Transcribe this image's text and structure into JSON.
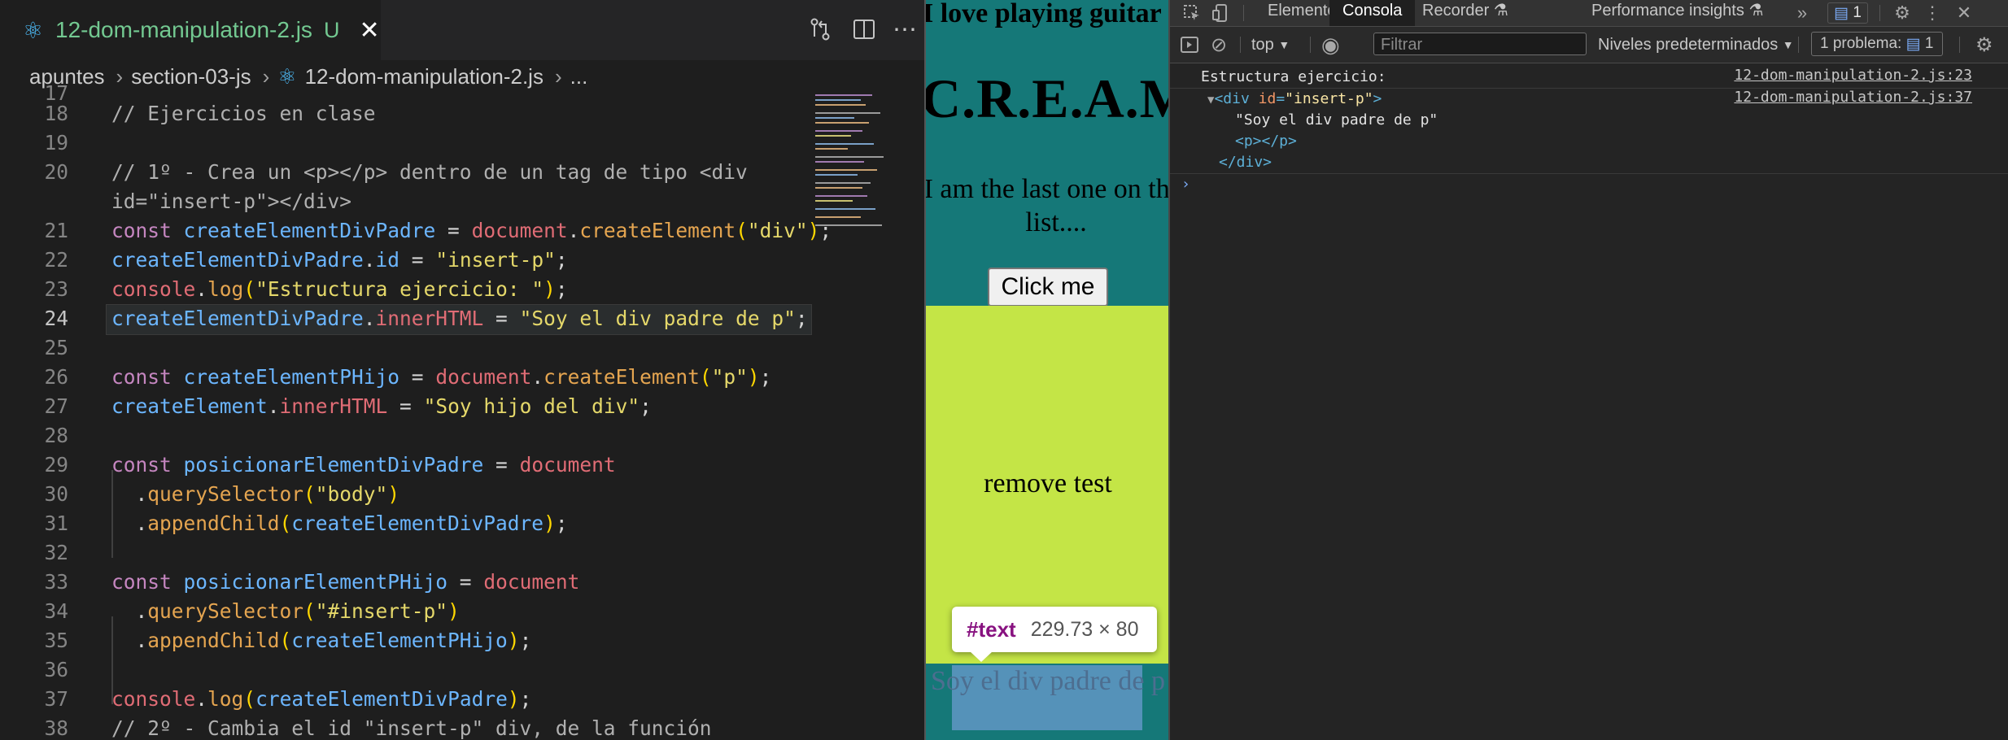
{
  "editor": {
    "tab": {
      "filename": "12-dom-manipulation-2.js",
      "status": "U",
      "close": "✕"
    },
    "breadcrumb": [
      "apuntes",
      "section-03-js",
      "12-dom-manipulation-2.js",
      "..."
    ],
    "lines": [
      {
        "n": "17",
        "t": ""
      },
      {
        "n": "18",
        "t": "// Ejercicios en clase"
      },
      {
        "n": "19",
        "t": ""
      },
      {
        "n": "20",
        "t": "// 1º - Crea un <p></p> dentro de un tag de tipo <div"
      },
      {
        "n": "",
        "t": "id=\"insert-p\"></div>"
      },
      {
        "n": "21",
        "t": "const createlementDivPadre"
      },
      {
        "n": "22",
        "t": "createElementDivPadre.id = \"insert-p\";"
      },
      {
        "n": "23",
        "t": "console.log(\"Estructura ejercicio: \");"
      },
      {
        "n": "24",
        "t": "createElementDivPadre.innerHTML = \"Soy el div padre de p\";"
      },
      {
        "n": "25",
        "t": ""
      },
      {
        "n": "26",
        "t": "const createElementPHijo = document.createElement(\"p\");"
      },
      {
        "n": "27",
        "t": "createElement.innerHTML = \"Soy hijo del div\";"
      },
      {
        "n": "28",
        "t": ""
      },
      {
        "n": "29",
        "t": "const posicionarElementDivPadre = document"
      },
      {
        "n": "30",
        "t": "  .querySelector(\"body\")"
      },
      {
        "n": "31",
        "t": "  .appendChild(createElementDivPadre);"
      },
      {
        "n": "32",
        "t": ""
      },
      {
        "n": "33",
        "t": "const posicionarElementPHijo = document"
      },
      {
        "n": "34",
        "t": "  .querySelector(\"#insert-p\")"
      },
      {
        "n": "35",
        "t": "  .appendChild(createElementPHijo);"
      },
      {
        "n": "36",
        "t": ""
      },
      {
        "n": "37",
        "t": "console.log(createElementDivPadre);"
      },
      {
        "n": "38",
        "t": "// 2º - Cambia el id \"insert-p\" div, de la función"
      }
    ],
    "code": {
      "l18": "// Ejercicios en clase",
      "l20a": "// 1º - Crea un <p></p> dentro de un tag de tipo <div",
      "l20b": "id=\"insert-p\"></div>",
      "kw_const": "const",
      "v_divpadre": "createElementDivPadre",
      "v_phijo": "createElementPHijo",
      "v_createElement": "createElement",
      "v_posDiv": "posicionarElementDivPadre",
      "v_posP": "posicionarElementPHijo",
      "o_document": "document",
      "o_console": "console",
      "f_createElement": "createElement",
      "f_log": "log",
      "f_querySelector": "querySelector",
      "f_appendChild": "appendChild",
      "p_id": "id",
      "p_innerHTML": "innerHTML",
      "s_div": "\"div\"",
      "s_insertp": "\"insert-p\"",
      "s_estructura": "\"Estructura ejercicio: \"",
      "s_soypadre": "\"Soy el div padre de p\"",
      "s_p": "\"p\"",
      "s_soyhijo": "\"Soy hijo del div\"",
      "s_body": "\"body\"",
      "s_hashinsert": "\"#insert-p\"",
      "l38": "// 2º - Cambia el id \"insert-p\" div, de la función"
    }
  },
  "page": {
    "h3": "I love playing guitar",
    "h1": "C.R.E.A.M",
    "p1": "I am the last one on this list....",
    "button": "Click me",
    "remove": "remove test",
    "selected_text": "Soy el div padre de p",
    "tooltip_node": "#text",
    "tooltip_size": "229.73 × 80"
  },
  "devtools": {
    "tabs": [
      "Elementos",
      "Consola",
      "Recorder",
      "Performance insights"
    ],
    "issues_count": "1",
    "context": "top",
    "filter_placeholder": "Filtrar",
    "levels": "Niveles predeterminados",
    "problems_label": "1 problema:",
    "problems_count": "1",
    "console": {
      "msg1": "Estructura ejercicio:",
      "src1": "12-dom-manipulation-2.js:23",
      "src2": "12-dom-manipulation-2.js:37",
      "div_open_tag": "<div",
      "attr_name": "id",
      "attr_val": "\"insert-p\"",
      "text_node": "\"Soy el div padre de p\"",
      "p_tags": "<p></p>",
      "div_close": "</div>"
    }
  },
  "colors": {
    "page_teal": "#157878",
    "page_green": "#c4e546",
    "tab_filename": "#73c991"
  }
}
